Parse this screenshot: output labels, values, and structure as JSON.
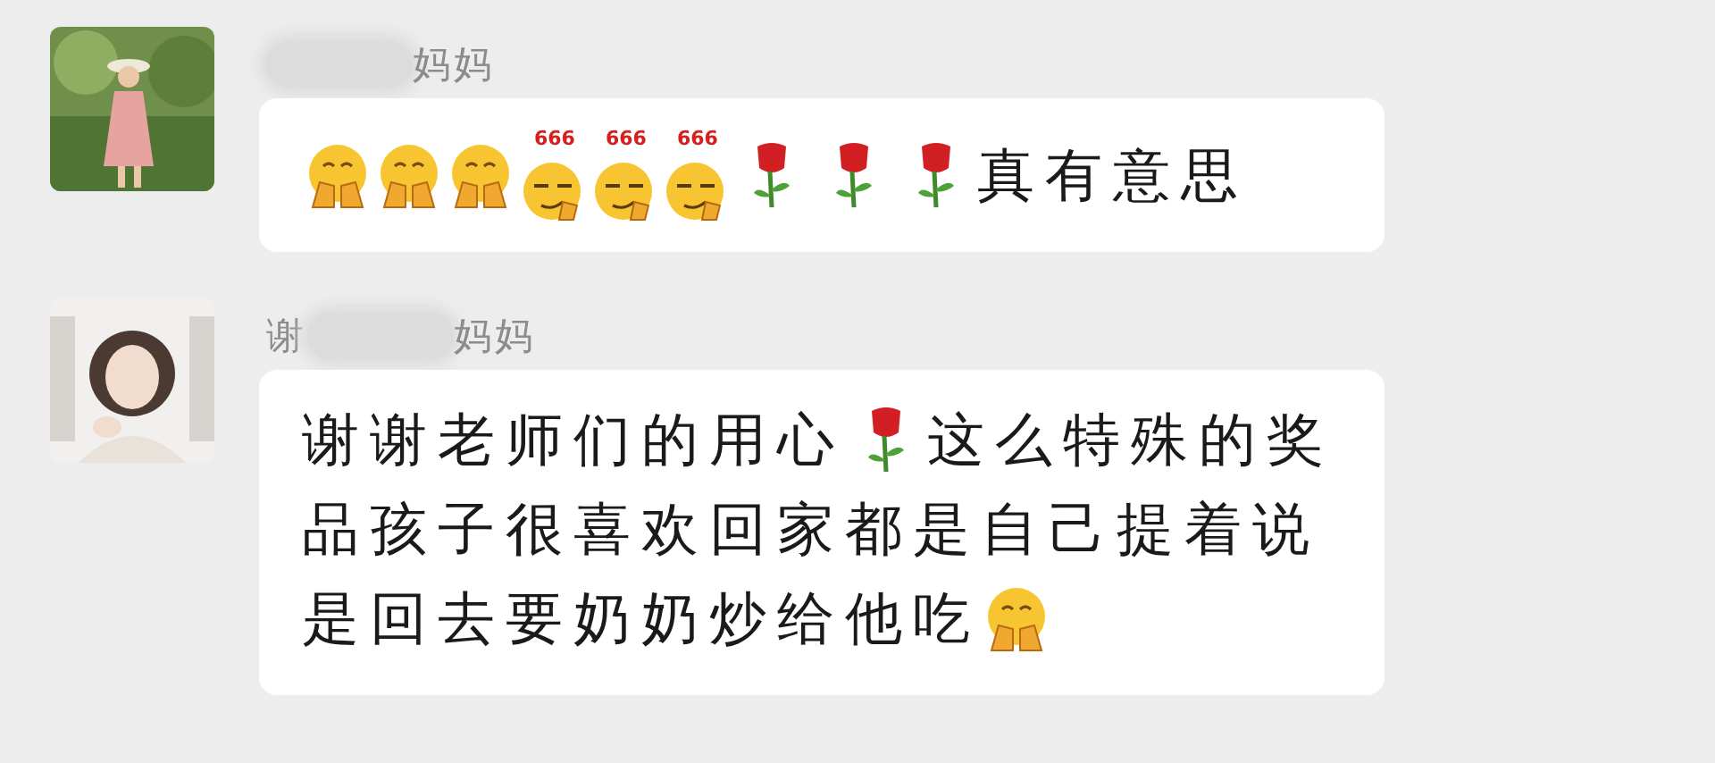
{
  "messages": [
    {
      "sender": {
        "blurred": true,
        "suffix": "妈妈"
      },
      "lines": [
        [
          {
            "kind": "cover-face"
          },
          {
            "kind": "cover-face"
          },
          {
            "kind": "cover-face"
          },
          {
            "kind": "smirk-666",
            "label": "666"
          },
          {
            "kind": "smirk-666",
            "label": "666"
          },
          {
            "kind": "smirk-666",
            "label": "666"
          },
          {
            "kind": "rose"
          },
          {
            "kind": "rose"
          },
          {
            "kind": "rose"
          },
          {
            "kind": "text",
            "text": "真有意思"
          }
        ]
      ]
    },
    {
      "sender": {
        "prefix": "谢",
        "blurred": true,
        "suffix": "妈妈"
      },
      "lines": [
        [
          {
            "kind": "text",
            "text": "谢谢老师们的用心"
          },
          {
            "kind": "rose"
          },
          {
            "kind": "text",
            "text": "这么特殊的奖"
          }
        ],
        [
          {
            "kind": "text",
            "text": "品孩子很喜欢回家都是自己提着说"
          }
        ],
        [
          {
            "kind": "text",
            "text": "是回去要奶奶炒给他吃"
          },
          {
            "kind": "cover-face"
          }
        ]
      ]
    }
  ]
}
